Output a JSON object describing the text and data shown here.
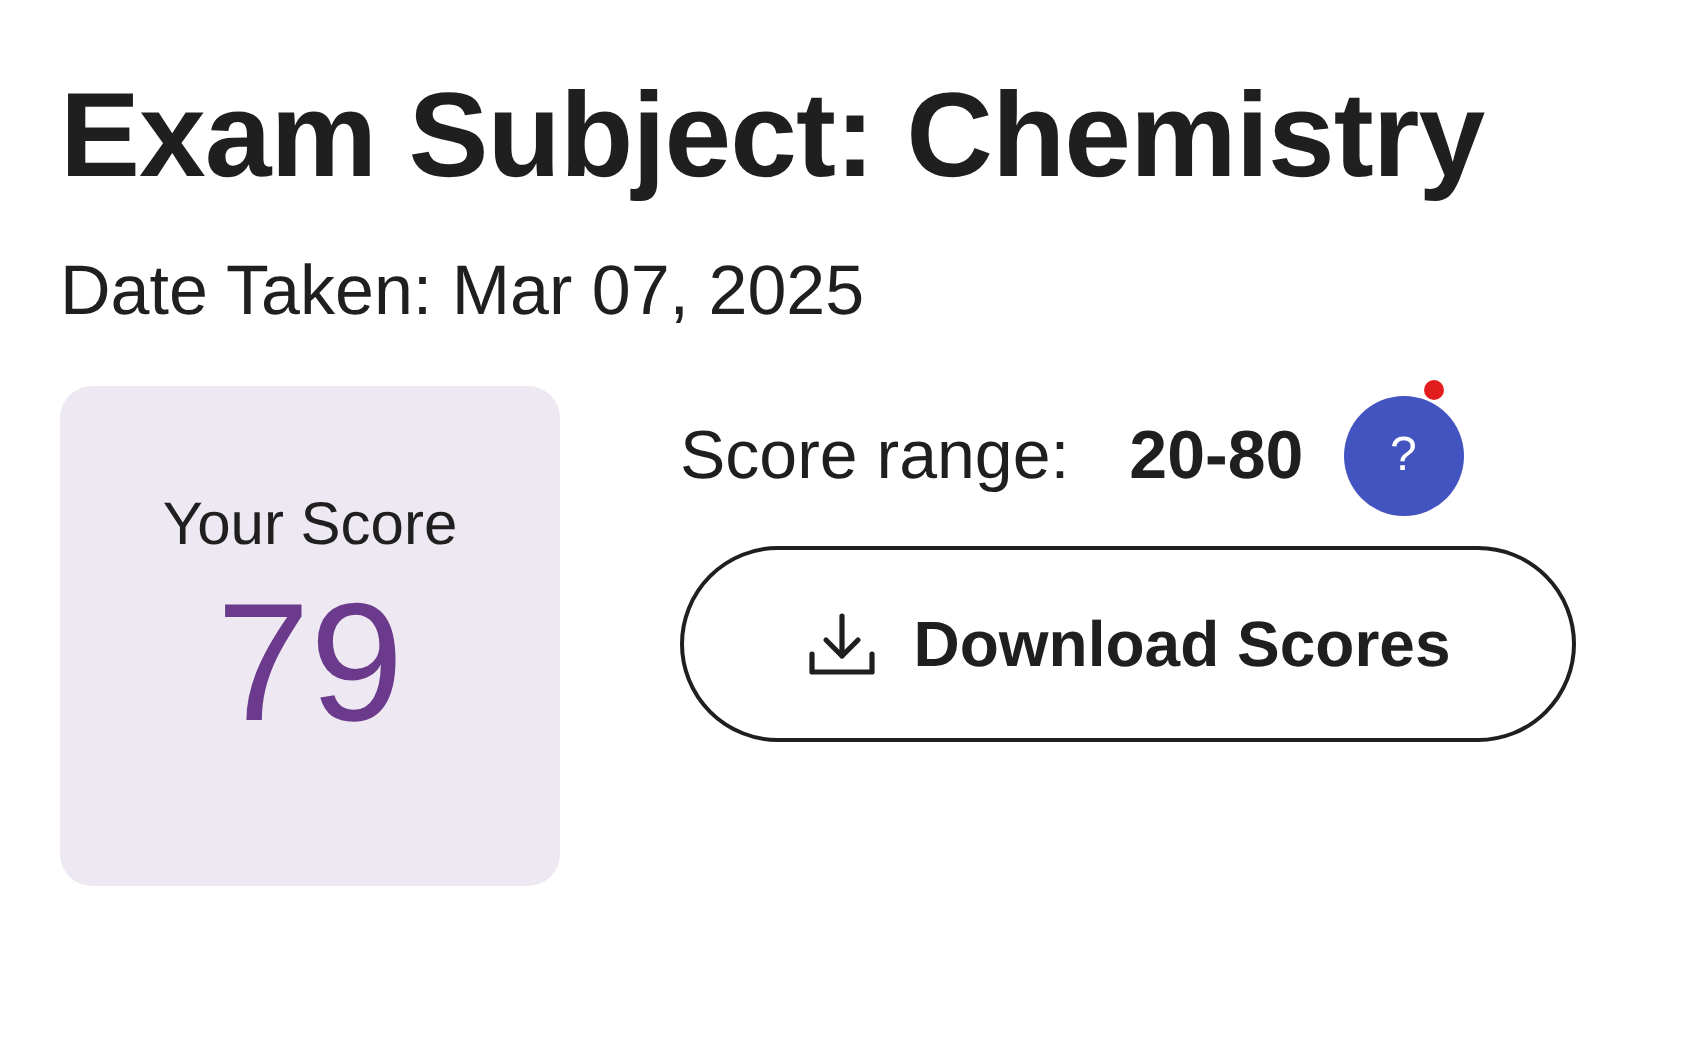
{
  "title": "Exam Subject: Chemistry",
  "date": "Date Taken: Mar 07, 2025",
  "score_card": {
    "label": "Your Score",
    "value": "79"
  },
  "score_range": {
    "label": "Score range:",
    "value": "20-80"
  },
  "help_button": {
    "label": "?",
    "notification": true
  },
  "download_button": {
    "label": "Download Scores"
  }
}
